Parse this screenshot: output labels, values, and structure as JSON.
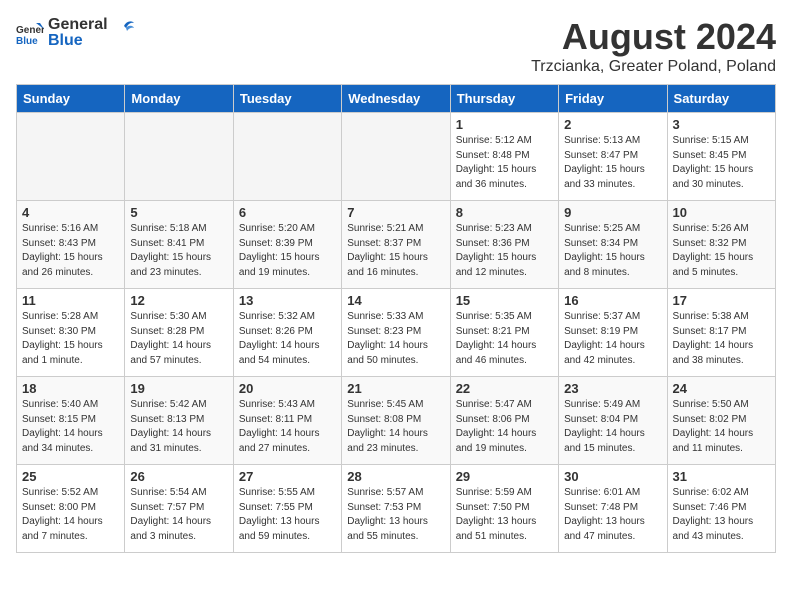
{
  "header": {
    "logo_general": "General",
    "logo_blue": "Blue",
    "title": "August 2024",
    "subtitle": "Trzcianka, Greater Poland, Poland"
  },
  "days_of_week": [
    "Sunday",
    "Monday",
    "Tuesday",
    "Wednesday",
    "Thursday",
    "Friday",
    "Saturday"
  ],
  "weeks": [
    [
      {
        "day": "",
        "info": ""
      },
      {
        "day": "",
        "info": ""
      },
      {
        "day": "",
        "info": ""
      },
      {
        "day": "",
        "info": ""
      },
      {
        "day": "1",
        "info": "Sunrise: 5:12 AM\nSunset: 8:48 PM\nDaylight: 15 hours\nand 36 minutes."
      },
      {
        "day": "2",
        "info": "Sunrise: 5:13 AM\nSunset: 8:47 PM\nDaylight: 15 hours\nand 33 minutes."
      },
      {
        "day": "3",
        "info": "Sunrise: 5:15 AM\nSunset: 8:45 PM\nDaylight: 15 hours\nand 30 minutes."
      }
    ],
    [
      {
        "day": "4",
        "info": "Sunrise: 5:16 AM\nSunset: 8:43 PM\nDaylight: 15 hours\nand 26 minutes."
      },
      {
        "day": "5",
        "info": "Sunrise: 5:18 AM\nSunset: 8:41 PM\nDaylight: 15 hours\nand 23 minutes."
      },
      {
        "day": "6",
        "info": "Sunrise: 5:20 AM\nSunset: 8:39 PM\nDaylight: 15 hours\nand 19 minutes."
      },
      {
        "day": "7",
        "info": "Sunrise: 5:21 AM\nSunset: 8:37 PM\nDaylight: 15 hours\nand 16 minutes."
      },
      {
        "day": "8",
        "info": "Sunrise: 5:23 AM\nSunset: 8:36 PM\nDaylight: 15 hours\nand 12 minutes."
      },
      {
        "day": "9",
        "info": "Sunrise: 5:25 AM\nSunset: 8:34 PM\nDaylight: 15 hours\nand 8 minutes."
      },
      {
        "day": "10",
        "info": "Sunrise: 5:26 AM\nSunset: 8:32 PM\nDaylight: 15 hours\nand 5 minutes."
      }
    ],
    [
      {
        "day": "11",
        "info": "Sunrise: 5:28 AM\nSunset: 8:30 PM\nDaylight: 15 hours\nand 1 minute."
      },
      {
        "day": "12",
        "info": "Sunrise: 5:30 AM\nSunset: 8:28 PM\nDaylight: 14 hours\nand 57 minutes."
      },
      {
        "day": "13",
        "info": "Sunrise: 5:32 AM\nSunset: 8:26 PM\nDaylight: 14 hours\nand 54 minutes."
      },
      {
        "day": "14",
        "info": "Sunrise: 5:33 AM\nSunset: 8:23 PM\nDaylight: 14 hours\nand 50 minutes."
      },
      {
        "day": "15",
        "info": "Sunrise: 5:35 AM\nSunset: 8:21 PM\nDaylight: 14 hours\nand 46 minutes."
      },
      {
        "day": "16",
        "info": "Sunrise: 5:37 AM\nSunset: 8:19 PM\nDaylight: 14 hours\nand 42 minutes."
      },
      {
        "day": "17",
        "info": "Sunrise: 5:38 AM\nSunset: 8:17 PM\nDaylight: 14 hours\nand 38 minutes."
      }
    ],
    [
      {
        "day": "18",
        "info": "Sunrise: 5:40 AM\nSunset: 8:15 PM\nDaylight: 14 hours\nand 34 minutes."
      },
      {
        "day": "19",
        "info": "Sunrise: 5:42 AM\nSunset: 8:13 PM\nDaylight: 14 hours\nand 31 minutes."
      },
      {
        "day": "20",
        "info": "Sunrise: 5:43 AM\nSunset: 8:11 PM\nDaylight: 14 hours\nand 27 minutes."
      },
      {
        "day": "21",
        "info": "Sunrise: 5:45 AM\nSunset: 8:08 PM\nDaylight: 14 hours\nand 23 minutes."
      },
      {
        "day": "22",
        "info": "Sunrise: 5:47 AM\nSunset: 8:06 PM\nDaylight: 14 hours\nand 19 minutes."
      },
      {
        "day": "23",
        "info": "Sunrise: 5:49 AM\nSunset: 8:04 PM\nDaylight: 14 hours\nand 15 minutes."
      },
      {
        "day": "24",
        "info": "Sunrise: 5:50 AM\nSunset: 8:02 PM\nDaylight: 14 hours\nand 11 minutes."
      }
    ],
    [
      {
        "day": "25",
        "info": "Sunrise: 5:52 AM\nSunset: 8:00 PM\nDaylight: 14 hours\nand 7 minutes."
      },
      {
        "day": "26",
        "info": "Sunrise: 5:54 AM\nSunset: 7:57 PM\nDaylight: 14 hours\nand 3 minutes."
      },
      {
        "day": "27",
        "info": "Sunrise: 5:55 AM\nSunset: 7:55 PM\nDaylight: 13 hours\nand 59 minutes."
      },
      {
        "day": "28",
        "info": "Sunrise: 5:57 AM\nSunset: 7:53 PM\nDaylight: 13 hours\nand 55 minutes."
      },
      {
        "day": "29",
        "info": "Sunrise: 5:59 AM\nSunset: 7:50 PM\nDaylight: 13 hours\nand 51 minutes."
      },
      {
        "day": "30",
        "info": "Sunrise: 6:01 AM\nSunset: 7:48 PM\nDaylight: 13 hours\nand 47 minutes."
      },
      {
        "day": "31",
        "info": "Sunrise: 6:02 AM\nSunset: 7:46 PM\nDaylight: 13 hours\nand 43 minutes."
      }
    ]
  ]
}
